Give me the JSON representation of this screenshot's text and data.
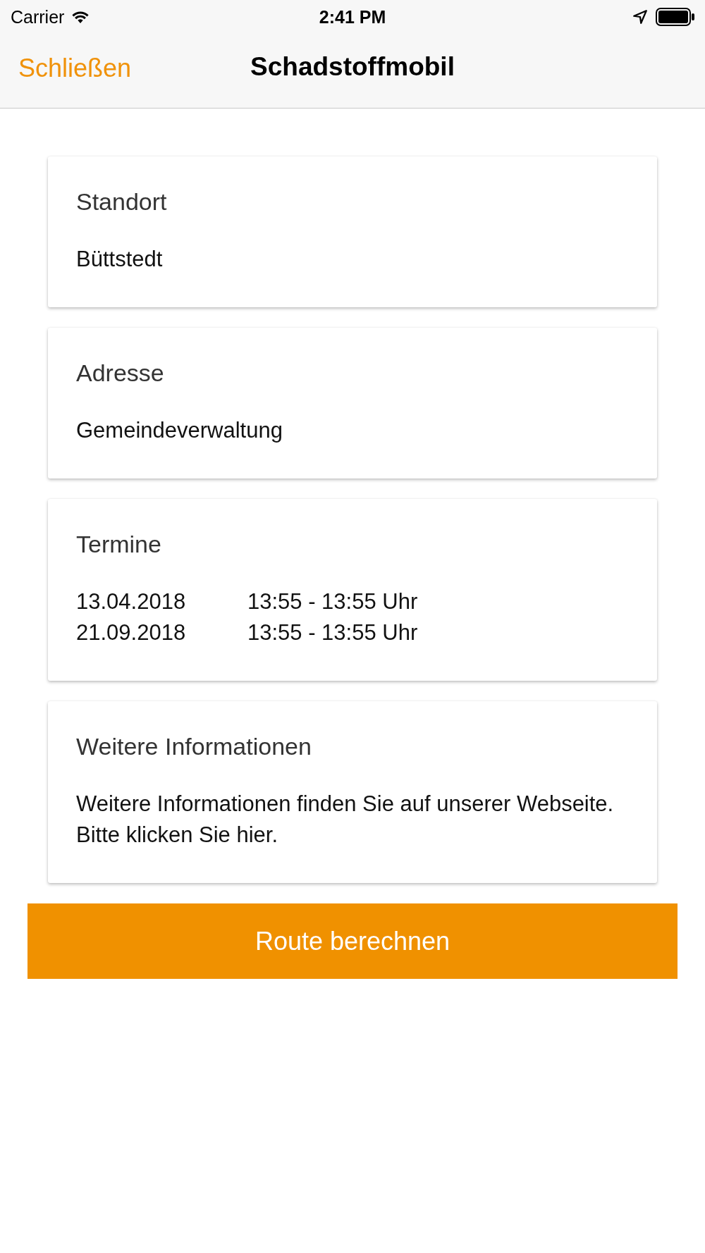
{
  "status_bar": {
    "carrier": "Carrier",
    "time": "2:41 PM"
  },
  "nav": {
    "close_label": "Schließen",
    "title": "Schadstoffmobil"
  },
  "cards": [
    {
      "kind": "text",
      "title": "Standort",
      "body": "Büttstedt"
    },
    {
      "kind": "text",
      "title": "Adresse",
      "body": "Gemeindeverwaltung"
    },
    {
      "kind": "dates",
      "title": "Termine",
      "rows": [
        {
          "date": "13.04.2018",
          "time": "13:55 - 13:55 Uhr"
        },
        {
          "date": "21.09.2018",
          "time": "13:55 - 13:55 Uhr"
        }
      ]
    },
    {
      "kind": "text",
      "title": "Weitere Informationen",
      "body": "Weitere Informationen finden Sie auf unserer Webseite. Bitte klicken Sie hier."
    }
  ],
  "button": {
    "label": "Route berechnen"
  }
}
